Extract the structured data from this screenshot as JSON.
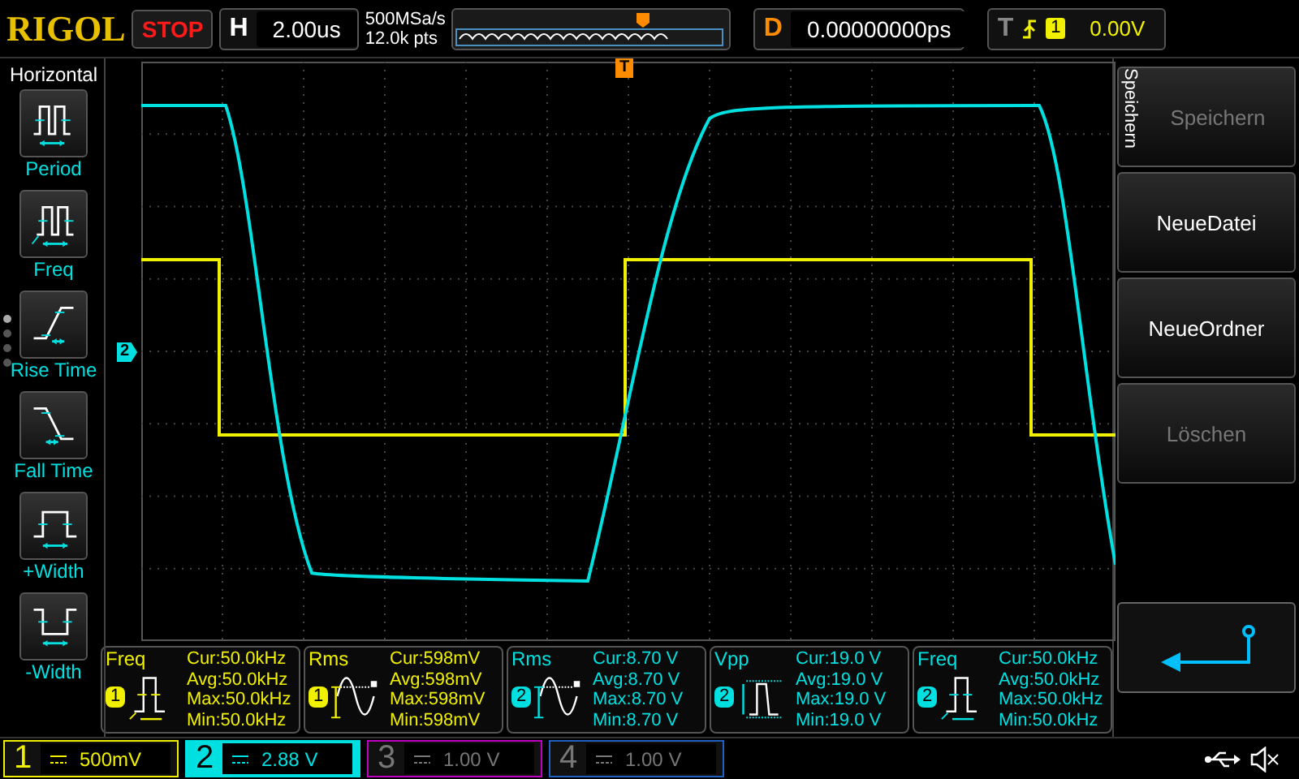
{
  "header": {
    "logo": "RIGOL",
    "run_state": "STOP",
    "timebase": {
      "label": "H",
      "value": "2.00us"
    },
    "sample_rate": "500MSa/s",
    "memory_depth": "12.0k pts",
    "delay": {
      "label": "D",
      "value": "0.00000000ps"
    },
    "trigger": {
      "label": "T",
      "source": "1",
      "level": "0.00V"
    }
  },
  "sidebar": {
    "title": "Horizontal",
    "items": [
      {
        "label": "Period",
        "kind": "period"
      },
      {
        "label": "Freq",
        "kind": "freq"
      },
      {
        "label": "Rise Time",
        "kind": "rise"
      },
      {
        "label": "Fall Time",
        "kind": "fall"
      },
      {
        "label": "+Width",
        "kind": "pwidth"
      },
      {
        "label": "-Width",
        "kind": "nwidth"
      }
    ]
  },
  "plot": {
    "trigger_marker": "T",
    "channel_marker": {
      "label": "2",
      "color": "#00e0e0"
    }
  },
  "measurements": [
    {
      "name": "Freq",
      "kind": "freq",
      "channel": "1",
      "color": "#f0f000",
      "lines": [
        "Cur:50.0kHz",
        "Avg:50.0kHz",
        "Max:50.0kHz",
        "Min:50.0kHz"
      ]
    },
    {
      "name": "Rms",
      "kind": "rms",
      "channel": "1",
      "color": "#f0f000",
      "lines": [
        "Cur:598mV",
        "Avg:598mV",
        "Max:598mV",
        "Min:598mV"
      ]
    },
    {
      "name": "Rms",
      "kind": "rms",
      "channel": "2",
      "color": "#00e0e0",
      "lines": [
        "Cur:8.70 V",
        "Avg:8.70 V",
        "Max:8.70 V",
        "Min:8.70 V"
      ]
    },
    {
      "name": "Vpp",
      "kind": "vpp",
      "channel": "2",
      "color": "#00e0e0",
      "lines": [
        "Cur:19.0 V",
        "Avg:19.0 V",
        "Max:19.0 V",
        "Min:19.0 V"
      ]
    },
    {
      "name": "Freq",
      "kind": "freq",
      "channel": "2",
      "color": "#00e0e0",
      "lines": [
        "Cur:50.0kHz",
        "Avg:50.0kHz",
        "Max:50.0kHz",
        "Min:50.0kHz"
      ]
    }
  ],
  "menu": {
    "title": "Speichern",
    "items": [
      {
        "label": "Speichern",
        "disabled": true
      },
      {
        "label": "NeueDatei",
        "disabled": false
      },
      {
        "label": "NeueOrdner",
        "disabled": false
      },
      {
        "label": "Löschen",
        "disabled": true
      }
    ]
  },
  "channels": [
    {
      "number": "1",
      "scale": "500mV",
      "color": "#f0f000",
      "enabled": true,
      "selected": false
    },
    {
      "number": "2",
      "scale": "2.88 V",
      "color": "#00e0e0",
      "enabled": true,
      "selected": true
    },
    {
      "number": "3",
      "scale": "1.00 V",
      "color": "#c000c0",
      "enabled": false,
      "selected": false
    },
    {
      "number": "4",
      "scale": "1.00 V",
      "color": "#2060c0",
      "enabled": false,
      "selected": false
    }
  ]
}
